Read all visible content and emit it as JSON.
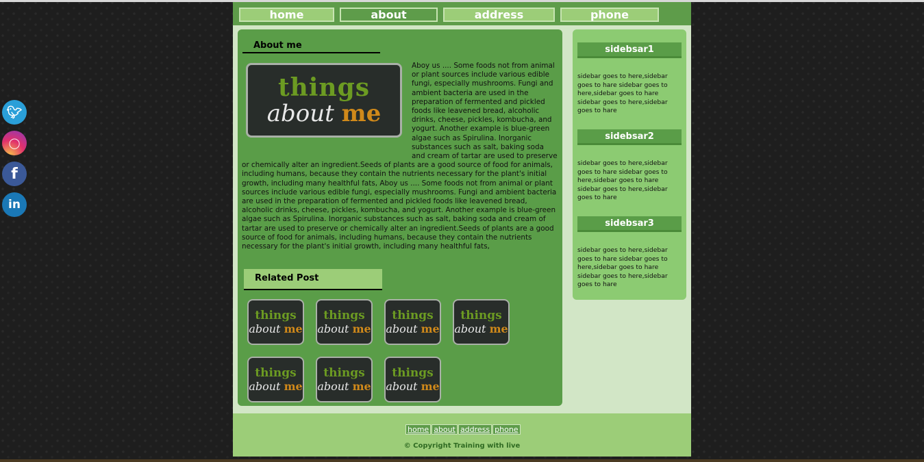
{
  "nav": {
    "items": [
      {
        "label": "home"
      },
      {
        "label": "about"
      },
      {
        "label": "address"
      },
      {
        "label": "phone"
      }
    ]
  },
  "social": {
    "icons": [
      "twitter-icon",
      "instagram-icon",
      "facebook-icon",
      "linkedin-icon"
    ]
  },
  "main": {
    "about_heading": "About me",
    "about_image": {
      "line1": "things",
      "line2_a": "about",
      "line2_b": "me"
    },
    "about_text": "Aboy us .... Some foods not from animal or plant sources include various edible fungi, especially mushrooms. Fungi and ambient bacteria are used in the preparation of fermented and pickled foods like leavened bread, alcoholic drinks, cheese, pickles, kombucha, and yogurt. Another example is blue-green algae such as Spirulina. Inorganic substances such as salt, baking soda and cream of tartar are used to preserve or chemically alter an ingredient.Seeds of plants are a good source of food for animals, including humans, because they contain the nutrients necessary for the plant's initial growth, including many healthful fats, Aboy us .... Some foods not from animal or plant sources include various edible fungi, especially mushrooms. Fungi and ambient bacteria are used in the preparation of fermented and pickled foods like leavened bread, alcoholic drinks, cheese, pickles, kombucha, and yogurt. Another example is blue-green algae such as Spirulina. Inorganic substances such as salt, baking soda and cream of tartar are used to preserve or chemically alter an ingredient.Seeds of plants are a good source of food for animals, including humans, because they contain the nutrients necessary for the plant's initial growth, including many healthful fats,",
    "related_heading": "Related Post",
    "thumb": {
      "line1": "things",
      "line2_a": "about",
      "line2_b": "me"
    }
  },
  "sidebar": {
    "sections": [
      {
        "title": "sidebsar1",
        "text": "sidebar goes to here,sidebar goes to hare sidebar goes to here,sidebar goes to hare sidebar goes to here,sidebar goes to hare"
      },
      {
        "title": "sidebsar2",
        "text": "sidebar goes to here,sidebar goes to hare sidebar goes to here,sidebar goes to hare sidebar goes to here,sidebar goes to hare"
      },
      {
        "title": "sidebsar3",
        "text": "sidebar goes to here,sidebar goes to hare sidebar goes to here,sidebar goes to hare sidebar goes to here,sidebar goes to hare"
      }
    ]
  },
  "footer": {
    "links": [
      {
        "label": "home"
      },
      {
        "label": "about"
      },
      {
        "label": "address"
      },
      {
        "label": "phone"
      }
    ],
    "copyright": "© Copyright Training with live"
  },
  "colors": {
    "nav_bg": "#5e9c4a",
    "nav_button": "#9ccd78",
    "content_bg": "#5a9d48",
    "sidebar_bg": "#8ccb72",
    "page_bg": "#d2e6c6",
    "accent_orange": "#d0891a"
  }
}
